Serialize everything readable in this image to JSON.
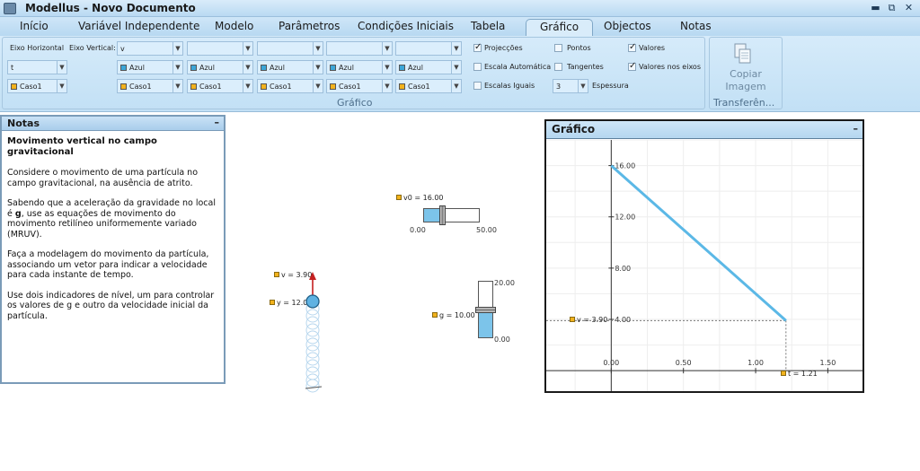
{
  "window": {
    "title": "Modellus - Novo Documento",
    "minimize": "▬",
    "restore": "⧉",
    "close": "✕"
  },
  "menu": {
    "tabs": [
      "Início",
      "Variável Independente",
      "Modelo",
      "Parâmetros",
      "Condições Iniciais",
      "Tabela",
      "Gráfico",
      "Objectos",
      "Notas"
    ],
    "active": "Gráfico"
  },
  "ribbon": {
    "eixo_horizontal_label": "Eixo Horizontal",
    "eixo_vertical_label": "Eixo Vertical:",
    "horizontal_var": "t",
    "horizontal_caso": "Caso1",
    "vertical_vars": [
      "v",
      "",
      "",
      "",
      ""
    ],
    "colors": [
      "Azul",
      "Azul",
      "Azul",
      "Azul",
      "Azul"
    ],
    "casos": [
      "Caso1",
      "Caso1",
      "Caso1",
      "Caso1",
      "Caso1"
    ],
    "checks": [
      {
        "label": "Projecções",
        "checked": true
      },
      {
        "label": "Pontos",
        "checked": false
      },
      {
        "label": "Valores",
        "checked": true
      },
      {
        "label": "Escala Automática",
        "checked": false
      },
      {
        "label": "Tangentes",
        "checked": false
      },
      {
        "label": "Valores nos eixos",
        "checked": true
      },
      {
        "label": "Escalas Iguais",
        "checked": false
      }
    ],
    "espessura_label": "Espessura",
    "espessura_value": "3",
    "group_label": "Gráfico",
    "copy_line1": "Copiar",
    "copy_line2": "Imagem",
    "transfer_label": "Transferên..."
  },
  "notes": {
    "title": "Notas",
    "minimize": "–",
    "heading": "Movimento vertical no campo gravitacional",
    "p1": "Considere o movimento de uma partícula no campo gravitacional, na ausência de atrito.",
    "p2_a": "Sabendo que a aceleração da gravidade no local é ",
    "p2_bold": "g",
    "p2_b": ", use as equações de movimento do movimento retilíneo uniformemente variado (MRUV).",
    "p3": "Faça a modelagem do movimento da partícula, associando um vetor para indicar a velocidade para cada instante de tempo.",
    "p4": "Use dois indicadores de nível, um para controlar os valores de g e outro da velocidade inicial da partícula."
  },
  "objects": {
    "v0_slider": {
      "label": "v0 = 16.00",
      "min": "0.00",
      "max": "50.00",
      "value": 16
    },
    "g_slider": {
      "label": "g = 10.00",
      "max": "20.00",
      "min": "0.00",
      "value": 10
    },
    "particle": {
      "v_label": "v = 3.90",
      "y_label": "y = 12.0"
    }
  },
  "graph_panel": {
    "title": "Gráfico",
    "minimize": "–",
    "v_label": "v = 3.90",
    "t_label": "t = 1.21"
  },
  "chart_data": {
    "type": "line",
    "x": [
      0.0,
      1.21
    ],
    "series": [
      {
        "values": [
          16.0,
          3.9
        ],
        "color": "#5bb8e6"
      }
    ],
    "xlim": [
      -0.45,
      1.74
    ],
    "ylim": [
      -1.6,
      18.0
    ],
    "x_ticks": [
      "0.00",
      "0.50",
      "1.00",
      "1.50"
    ],
    "y_ticks": [
      "4.00",
      "8.00",
      "12.00",
      "16.00"
    ],
    "grid": true,
    "projections": {
      "x": 1.21,
      "y": 3.9
    }
  }
}
